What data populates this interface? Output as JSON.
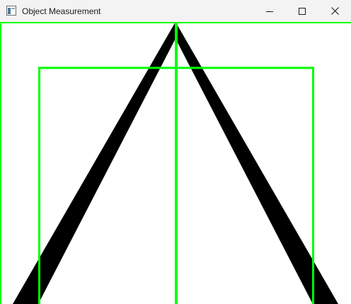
{
  "window": {
    "title": "Object Measurement",
    "controls": {
      "minimize_icon": "minimize-icon",
      "maximize_icon": "maximize-icon",
      "close_icon": "close-icon"
    }
  },
  "colors": {
    "titlebar_bg": "#f3f3f3",
    "canvas_bg": "#ffffff",
    "detection_green": "#00ff00",
    "object_black": "#000000"
  }
}
